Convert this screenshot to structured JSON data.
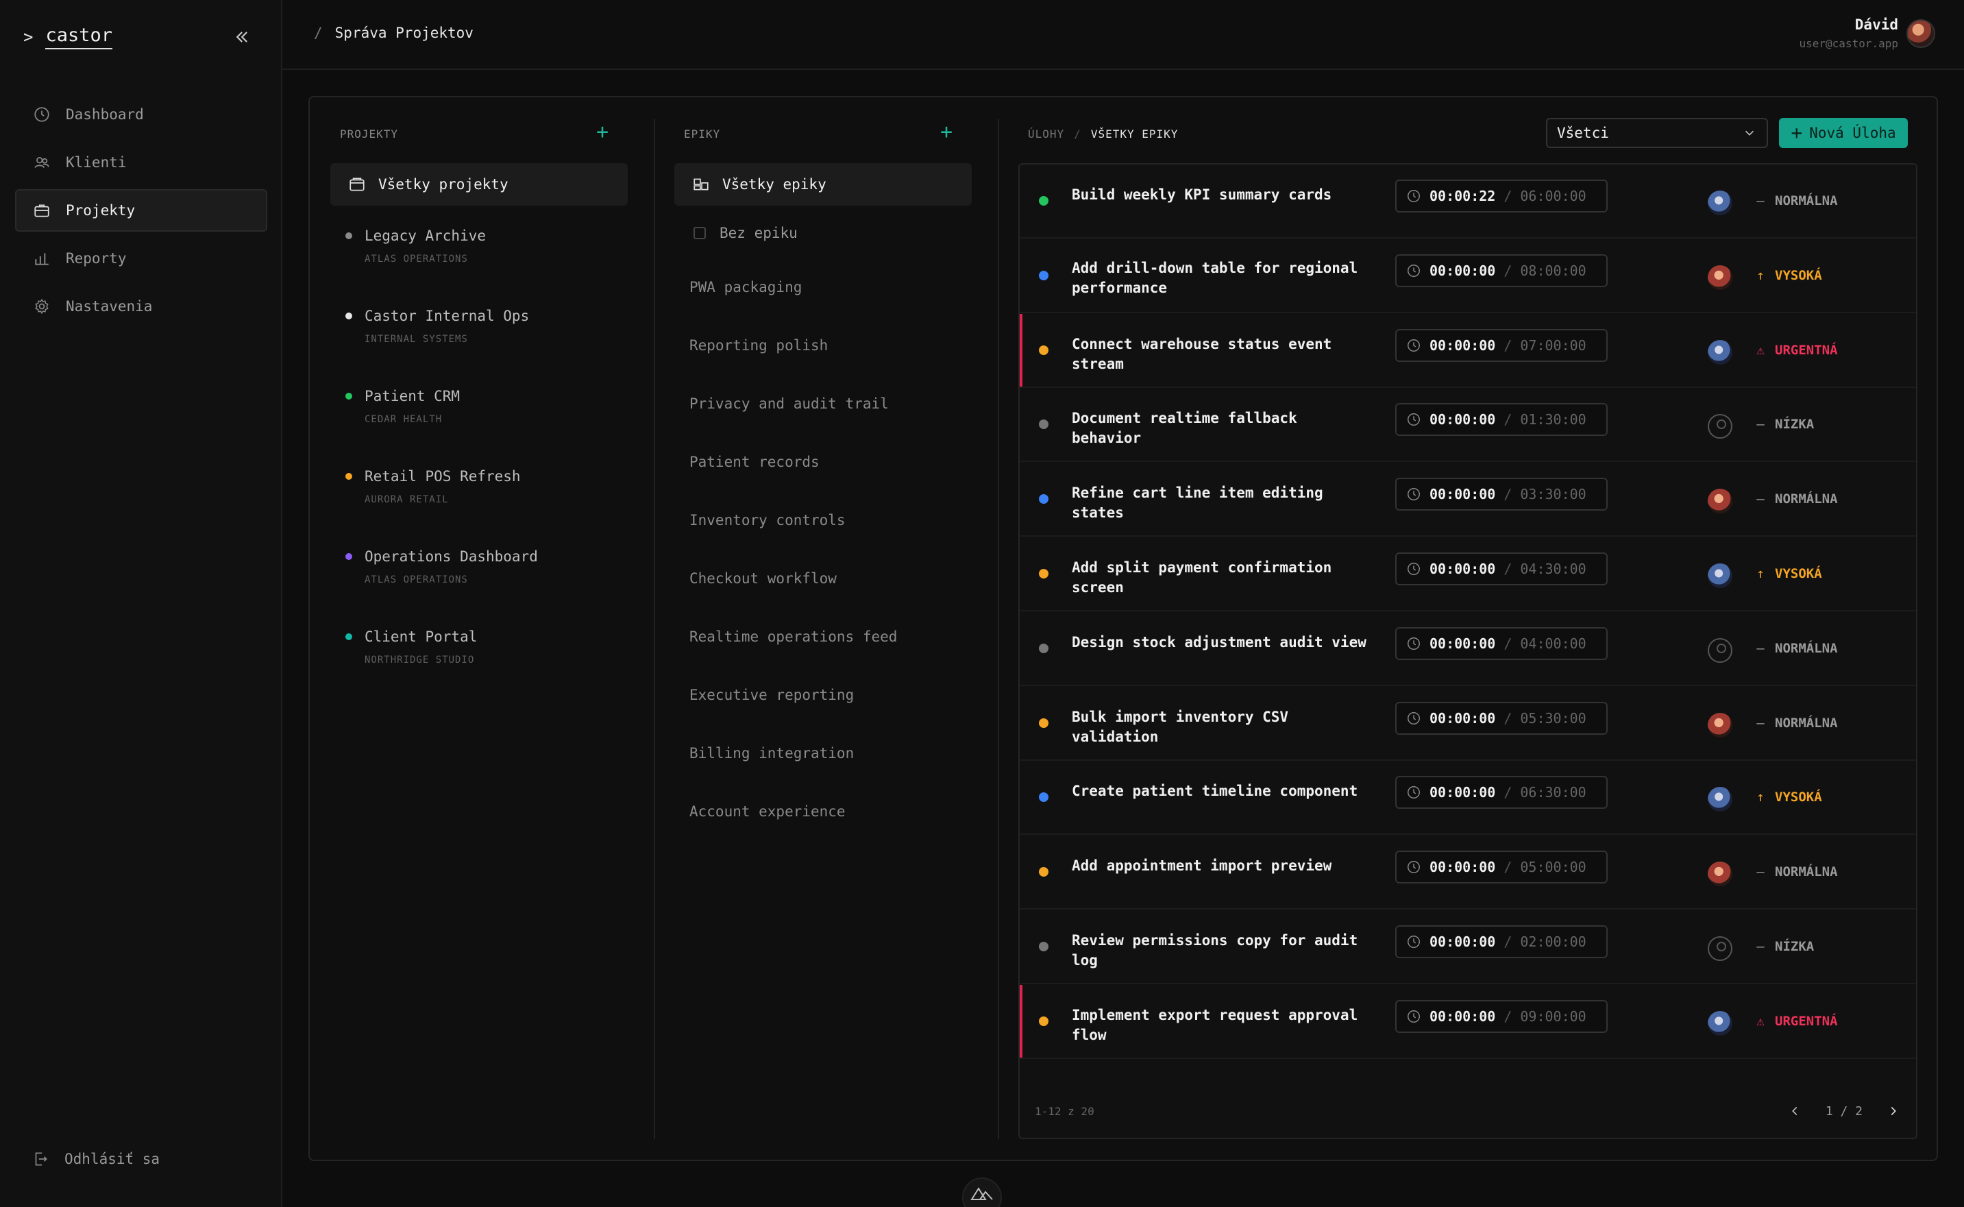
{
  "app": {
    "brand": "castor"
  },
  "sidebar": {
    "items": [
      {
        "label": "Dashboard",
        "icon": "clock-icon"
      },
      {
        "label": "Klienti",
        "icon": "users-icon"
      },
      {
        "label": "Projekty",
        "icon": "briefcase-icon",
        "active": true
      },
      {
        "label": "Reporty",
        "icon": "bar-chart-icon"
      },
      {
        "label": "Nastavenia",
        "icon": "gear-icon"
      }
    ],
    "logout": "Odhlásiť sa"
  },
  "header": {
    "breadcrumb_sep": "/",
    "breadcrumb": "Správa Projektov",
    "user_name": "Dávid",
    "user_email": "user@castor.app"
  },
  "projects": {
    "heading": "PROJEKTY",
    "all_label": "Všetky projekty",
    "items": [
      {
        "name": "Legacy Archive",
        "client": "ATLAS OPERATIONS",
        "color": "#8a8a8a"
      },
      {
        "name": "Castor Internal Ops",
        "client": "INTERNAL SYSTEMS",
        "color": "#e6e6e6"
      },
      {
        "name": "Patient CRM",
        "client": "CEDAR HEALTH",
        "color": "#22c55e"
      },
      {
        "name": "Retail POS Refresh",
        "client": "AURORA RETAIL",
        "color": "#f5a524"
      },
      {
        "name": "Operations Dashboard",
        "client": "ATLAS OPERATIONS",
        "color": "#8b5cf6"
      },
      {
        "name": "Client Portal",
        "client": "NORTHRIDGE STUDIO",
        "color": "#14b8a6"
      }
    ]
  },
  "epics": {
    "heading": "EPIKY",
    "all_label": "Všetky epiky",
    "no_epic": "Bez epiku",
    "items": [
      "PWA packaging",
      "Reporting polish",
      "Privacy and audit trail",
      "Patient records",
      "Inventory controls",
      "Checkout workflow",
      "Realtime operations feed",
      "Executive reporting",
      "Billing integration",
      "Account experience"
    ]
  },
  "tasks": {
    "crumb_root": "ÚLOHY",
    "crumb_sep": "/",
    "crumb_current": "VŠETKY EPIKY",
    "filter_value": "Všetci",
    "new_task_label": "Nová Úloha",
    "time_sep": "/",
    "rows": [
      {
        "title": "Build weekly KPI summary cards",
        "dot": "#22c55e",
        "elapsed": "00:00:22",
        "estimate": "06:00:00",
        "avatar": "a",
        "priority": "NORMÁLNA",
        "pclass": "p-norm",
        "picon": "—",
        "urgent": false
      },
      {
        "title": "Add drill-down table for regional performance",
        "dot": "#3b82f6",
        "elapsed": "00:00:00",
        "estimate": "08:00:00",
        "avatar": "b",
        "priority": "VYSOKÁ",
        "pclass": "p-high",
        "picon": "↑",
        "urgent": false
      },
      {
        "title": "Connect warehouse status event stream",
        "dot": "#f5a524",
        "elapsed": "00:00:00",
        "estimate": "07:00:00",
        "avatar": "a",
        "priority": "URGENTNÁ",
        "pclass": "p-urg",
        "picon": "⚠",
        "urgent": true
      },
      {
        "title": "Document realtime fallback behavior",
        "dot": "#777777",
        "elapsed": "00:00:00",
        "estimate": "01:30:00",
        "avatar": "none",
        "priority": "NÍZKA",
        "pclass": "p-low",
        "picon": "—",
        "urgent": false
      },
      {
        "title": "Refine cart line item editing states",
        "dot": "#3b82f6",
        "elapsed": "00:00:00",
        "estimate": "03:30:00",
        "avatar": "b",
        "priority": "NORMÁLNA",
        "pclass": "p-norm",
        "picon": "—",
        "urgent": false
      },
      {
        "title": "Add split payment confirmation screen",
        "dot": "#f5a524",
        "elapsed": "00:00:00",
        "estimate": "04:30:00",
        "avatar": "a",
        "priority": "VYSOKÁ",
        "pclass": "p-high",
        "picon": "↑",
        "urgent": false
      },
      {
        "title": "Design stock adjustment audit view",
        "dot": "#777777",
        "elapsed": "00:00:00",
        "estimate": "04:00:00",
        "avatar": "none",
        "priority": "NORMÁLNA",
        "pclass": "p-norm",
        "picon": "—",
        "urgent": false
      },
      {
        "title": "Bulk import inventory CSV validation",
        "dot": "#f5a524",
        "elapsed": "00:00:00",
        "estimate": "05:30:00",
        "avatar": "b",
        "priority": "NORMÁLNA",
        "pclass": "p-norm",
        "picon": "—",
        "urgent": false
      },
      {
        "title": "Create patient timeline component",
        "dot": "#3b82f6",
        "elapsed": "00:00:00",
        "estimate": "06:30:00",
        "avatar": "a",
        "priority": "VYSOKÁ",
        "pclass": "p-high",
        "picon": "↑",
        "urgent": false
      },
      {
        "title": "Add appointment import preview",
        "dot": "#f5a524",
        "elapsed": "00:00:00",
        "estimate": "05:00:00",
        "avatar": "b",
        "priority": "NORMÁLNA",
        "pclass": "p-norm",
        "picon": "—",
        "urgent": false
      },
      {
        "title": "Review permissions copy for audit log",
        "dot": "#777777",
        "elapsed": "00:00:00",
        "estimate": "02:00:00",
        "avatar": "none",
        "priority": "NÍZKA",
        "pclass": "p-low",
        "picon": "—",
        "urgent": false
      },
      {
        "title": "Implement export request approval flow",
        "dot": "#f5a524",
        "elapsed": "00:00:00",
        "estimate": "09:00:00",
        "avatar": "a",
        "priority": "URGENTNÁ",
        "pclass": "p-urg",
        "picon": "⚠",
        "urgent": true
      }
    ],
    "range": "1-12 z 20",
    "page": "1 / 2"
  }
}
